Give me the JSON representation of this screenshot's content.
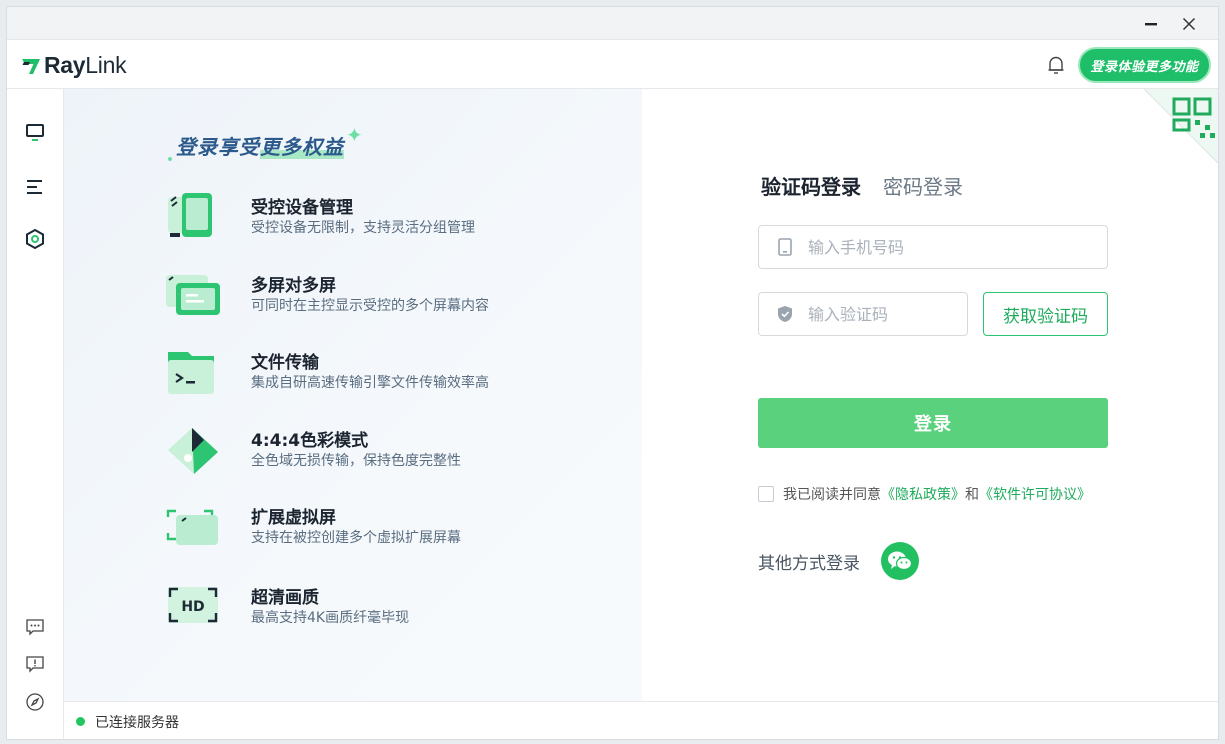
{
  "window": {
    "minimize_icon": "minimize-icon",
    "close_icon": "close-icon"
  },
  "header": {
    "logo_prefix": "Ray",
    "logo_suffix": "Link",
    "upgrade_label": "登录体验更多功能",
    "accent": "#1fbf6a"
  },
  "sidebar": {
    "top_items": [
      {
        "icon": "monitor-icon"
      },
      {
        "icon": "list-icon"
      },
      {
        "icon": "settings-icon"
      }
    ],
    "bottom_items": [
      {
        "icon": "chat-icon"
      },
      {
        "icon": "feedback-icon"
      },
      {
        "icon": "compass-icon"
      }
    ]
  },
  "features": {
    "headline_prefix": "登录享受",
    "headline_highlight": "更多权益",
    "items": [
      {
        "icon": "device-manage-icon",
        "title": "受控设备管理",
        "desc": "受控设备无限制，支持灵活分组管理"
      },
      {
        "icon": "multi-screen-icon",
        "title": "多屏对多屏",
        "desc": "可同时在主控显示受控的多个屏幕内容"
      },
      {
        "icon": "file-transfer-icon",
        "title": "文件传输",
        "desc": "集成自研高速传输引擎文件传输效率高"
      },
      {
        "icon": "color-mode-icon",
        "title": "4:4:4色彩模式",
        "desc": "全色域无损传输，保持色度完整性"
      },
      {
        "icon": "virtual-screen-icon",
        "title": "扩展虚拟屏",
        "desc": "支持在被控创建多个虚拟扩展屏幕"
      },
      {
        "icon": "hd-icon",
        "title": "超清画质",
        "desc": "最高支持4K画质纤毫毕现"
      }
    ]
  },
  "login": {
    "tab_sms": "验证码登录",
    "tab_password": "密码登录",
    "phone_placeholder": "输入手机号码",
    "phone_value": "",
    "code_placeholder": "输入验证码",
    "code_value": "",
    "get_code_label": "获取验证码",
    "login_label": "登录",
    "agree_text": "我已阅读并同意",
    "privacy_link": "《隐私政策》",
    "and_text": "和",
    "license_link": "《软件许可协议》",
    "other_login_label": "其他方式登录",
    "login_button_color": "#5ad17c"
  },
  "status": {
    "text": "已连接服务器",
    "color": "#22c55e"
  }
}
